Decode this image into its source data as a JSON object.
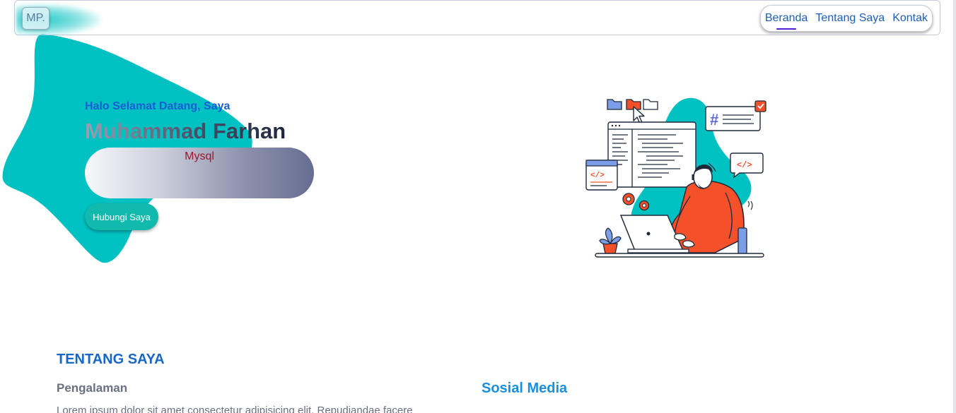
{
  "nav": {
    "logo": "MP.",
    "links": [
      "Beranda",
      "Tentang Saya",
      "Kontak"
    ],
    "active": "Beranda"
  },
  "hero": {
    "greeting": "Halo Selamat Datang, Saya",
    "name": "Muhammad Farhan",
    "skill": "Mysql",
    "cta_label": "Hubungi Saya"
  },
  "illustration": {
    "icon": "developer-at-laptop-illustration",
    "code_tag": "</>",
    "hash": "#"
  },
  "about": {
    "title": "TENTANG SAYA",
    "subtitle": "Pengalaman",
    "text": "Lorem ipsum dolor sit amet consectetur adipisicing elit. Repudiandae facere",
    "social_title": "Sosial Media"
  },
  "colors": {
    "accent": "#00c1c1",
    "primary_blue": "#1767c9",
    "cta": "#12b9ad",
    "illustration_orange": "#f4502a"
  }
}
